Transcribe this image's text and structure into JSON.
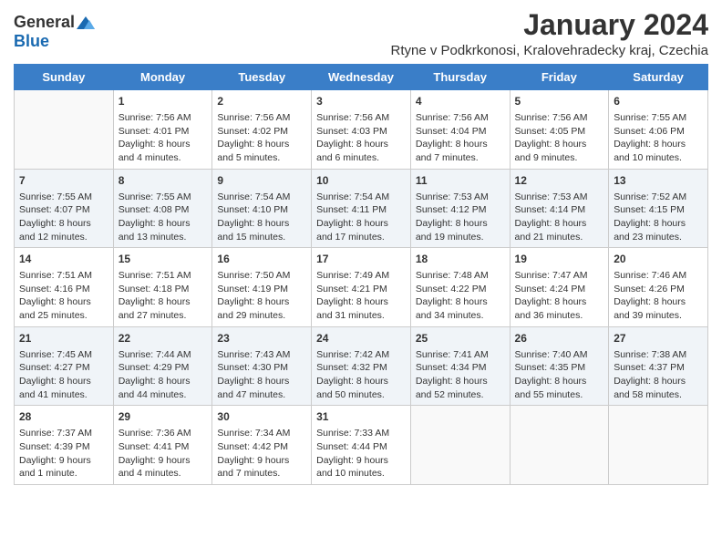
{
  "logo": {
    "general": "General",
    "blue": "Blue"
  },
  "title": "January 2024",
  "subtitle": "Rtyne v Podkrkonosi, Kralovehradecky kraj, Czechia",
  "weekdays": [
    "Sunday",
    "Monday",
    "Tuesday",
    "Wednesday",
    "Thursday",
    "Friday",
    "Saturday"
  ],
  "weeks": [
    {
      "shaded": false,
      "days": [
        {
          "num": "",
          "sunrise": "",
          "sunset": "",
          "daylight": ""
        },
        {
          "num": "1",
          "sunrise": "Sunrise: 7:56 AM",
          "sunset": "Sunset: 4:01 PM",
          "daylight": "Daylight: 8 hours and 4 minutes."
        },
        {
          "num": "2",
          "sunrise": "Sunrise: 7:56 AM",
          "sunset": "Sunset: 4:02 PM",
          "daylight": "Daylight: 8 hours and 5 minutes."
        },
        {
          "num": "3",
          "sunrise": "Sunrise: 7:56 AM",
          "sunset": "Sunset: 4:03 PM",
          "daylight": "Daylight: 8 hours and 6 minutes."
        },
        {
          "num": "4",
          "sunrise": "Sunrise: 7:56 AM",
          "sunset": "Sunset: 4:04 PM",
          "daylight": "Daylight: 8 hours and 7 minutes."
        },
        {
          "num": "5",
          "sunrise": "Sunrise: 7:56 AM",
          "sunset": "Sunset: 4:05 PM",
          "daylight": "Daylight: 8 hours and 9 minutes."
        },
        {
          "num": "6",
          "sunrise": "Sunrise: 7:55 AM",
          "sunset": "Sunset: 4:06 PM",
          "daylight": "Daylight: 8 hours and 10 minutes."
        }
      ]
    },
    {
      "shaded": true,
      "days": [
        {
          "num": "7",
          "sunrise": "Sunrise: 7:55 AM",
          "sunset": "Sunset: 4:07 PM",
          "daylight": "Daylight: 8 hours and 12 minutes."
        },
        {
          "num": "8",
          "sunrise": "Sunrise: 7:55 AM",
          "sunset": "Sunset: 4:08 PM",
          "daylight": "Daylight: 8 hours and 13 minutes."
        },
        {
          "num": "9",
          "sunrise": "Sunrise: 7:54 AM",
          "sunset": "Sunset: 4:10 PM",
          "daylight": "Daylight: 8 hours and 15 minutes."
        },
        {
          "num": "10",
          "sunrise": "Sunrise: 7:54 AM",
          "sunset": "Sunset: 4:11 PM",
          "daylight": "Daylight: 8 hours and 17 minutes."
        },
        {
          "num": "11",
          "sunrise": "Sunrise: 7:53 AM",
          "sunset": "Sunset: 4:12 PM",
          "daylight": "Daylight: 8 hours and 19 minutes."
        },
        {
          "num": "12",
          "sunrise": "Sunrise: 7:53 AM",
          "sunset": "Sunset: 4:14 PM",
          "daylight": "Daylight: 8 hours and 21 minutes."
        },
        {
          "num": "13",
          "sunrise": "Sunrise: 7:52 AM",
          "sunset": "Sunset: 4:15 PM",
          "daylight": "Daylight: 8 hours and 23 minutes."
        }
      ]
    },
    {
      "shaded": false,
      "days": [
        {
          "num": "14",
          "sunrise": "Sunrise: 7:51 AM",
          "sunset": "Sunset: 4:16 PM",
          "daylight": "Daylight: 8 hours and 25 minutes."
        },
        {
          "num": "15",
          "sunrise": "Sunrise: 7:51 AM",
          "sunset": "Sunset: 4:18 PM",
          "daylight": "Daylight: 8 hours and 27 minutes."
        },
        {
          "num": "16",
          "sunrise": "Sunrise: 7:50 AM",
          "sunset": "Sunset: 4:19 PM",
          "daylight": "Daylight: 8 hours and 29 minutes."
        },
        {
          "num": "17",
          "sunrise": "Sunrise: 7:49 AM",
          "sunset": "Sunset: 4:21 PM",
          "daylight": "Daylight: 8 hours and 31 minutes."
        },
        {
          "num": "18",
          "sunrise": "Sunrise: 7:48 AM",
          "sunset": "Sunset: 4:22 PM",
          "daylight": "Daylight: 8 hours and 34 minutes."
        },
        {
          "num": "19",
          "sunrise": "Sunrise: 7:47 AM",
          "sunset": "Sunset: 4:24 PM",
          "daylight": "Daylight: 8 hours and 36 minutes."
        },
        {
          "num": "20",
          "sunrise": "Sunrise: 7:46 AM",
          "sunset": "Sunset: 4:26 PM",
          "daylight": "Daylight: 8 hours and 39 minutes."
        }
      ]
    },
    {
      "shaded": true,
      "days": [
        {
          "num": "21",
          "sunrise": "Sunrise: 7:45 AM",
          "sunset": "Sunset: 4:27 PM",
          "daylight": "Daylight: 8 hours and 41 minutes."
        },
        {
          "num": "22",
          "sunrise": "Sunrise: 7:44 AM",
          "sunset": "Sunset: 4:29 PM",
          "daylight": "Daylight: 8 hours and 44 minutes."
        },
        {
          "num": "23",
          "sunrise": "Sunrise: 7:43 AM",
          "sunset": "Sunset: 4:30 PM",
          "daylight": "Daylight: 8 hours and 47 minutes."
        },
        {
          "num": "24",
          "sunrise": "Sunrise: 7:42 AM",
          "sunset": "Sunset: 4:32 PM",
          "daylight": "Daylight: 8 hours and 50 minutes."
        },
        {
          "num": "25",
          "sunrise": "Sunrise: 7:41 AM",
          "sunset": "Sunset: 4:34 PM",
          "daylight": "Daylight: 8 hours and 52 minutes."
        },
        {
          "num": "26",
          "sunrise": "Sunrise: 7:40 AM",
          "sunset": "Sunset: 4:35 PM",
          "daylight": "Daylight: 8 hours and 55 minutes."
        },
        {
          "num": "27",
          "sunrise": "Sunrise: 7:38 AM",
          "sunset": "Sunset: 4:37 PM",
          "daylight": "Daylight: 8 hours and 58 minutes."
        }
      ]
    },
    {
      "shaded": false,
      "days": [
        {
          "num": "28",
          "sunrise": "Sunrise: 7:37 AM",
          "sunset": "Sunset: 4:39 PM",
          "daylight": "Daylight: 9 hours and 1 minute."
        },
        {
          "num": "29",
          "sunrise": "Sunrise: 7:36 AM",
          "sunset": "Sunset: 4:41 PM",
          "daylight": "Daylight: 9 hours and 4 minutes."
        },
        {
          "num": "30",
          "sunrise": "Sunrise: 7:34 AM",
          "sunset": "Sunset: 4:42 PM",
          "daylight": "Daylight: 9 hours and 7 minutes."
        },
        {
          "num": "31",
          "sunrise": "Sunrise: 7:33 AM",
          "sunset": "Sunset: 4:44 PM",
          "daylight": "Daylight: 9 hours and 10 minutes."
        },
        {
          "num": "",
          "sunrise": "",
          "sunset": "",
          "daylight": ""
        },
        {
          "num": "",
          "sunrise": "",
          "sunset": "",
          "daylight": ""
        },
        {
          "num": "",
          "sunrise": "",
          "sunset": "",
          "daylight": ""
        }
      ]
    }
  ]
}
